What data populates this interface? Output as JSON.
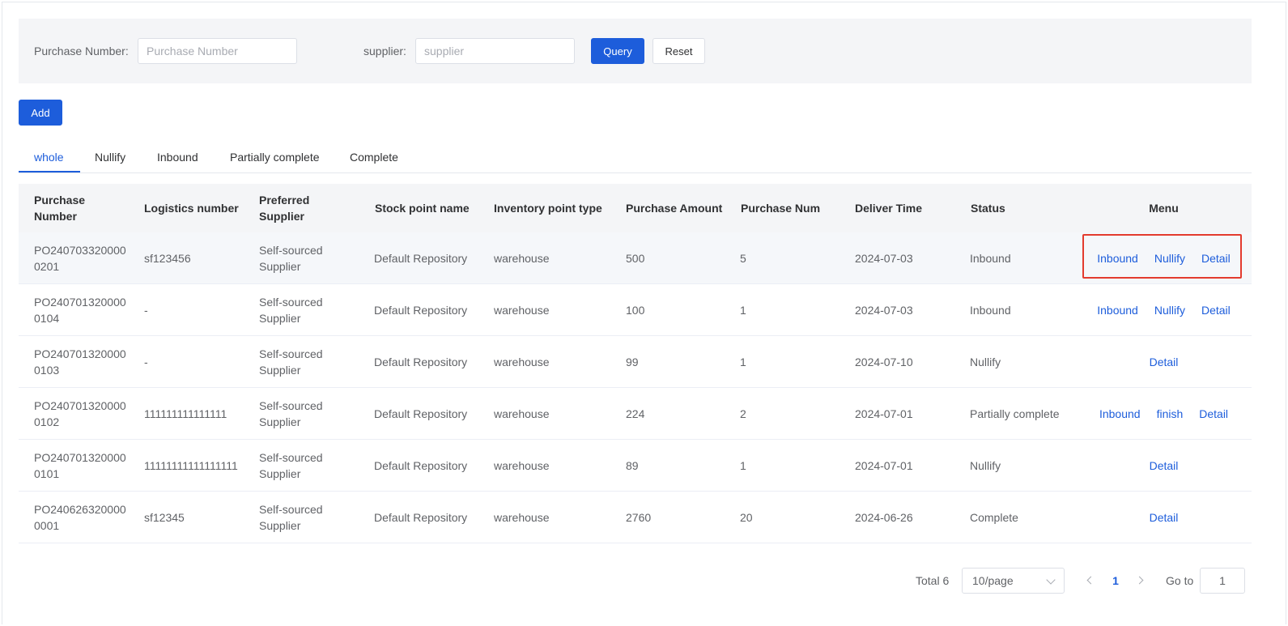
{
  "search": {
    "purchase_number_label": "Purchase Number:",
    "purchase_number_placeholder": "Purchase Number",
    "purchase_number_value": "",
    "supplier_label": "supplier:",
    "supplier_placeholder": "supplier",
    "supplier_value": "",
    "query_label": "Query",
    "reset_label": "Reset"
  },
  "toolbar": {
    "add_label": "Add"
  },
  "tabs": [
    {
      "label": "whole",
      "active": true
    },
    {
      "label": "Nullify",
      "active": false
    },
    {
      "label": "Inbound",
      "active": false
    },
    {
      "label": "Partially complete",
      "active": false
    },
    {
      "label": "Complete",
      "active": false
    }
  ],
  "table": {
    "columns": [
      "Purchase Number",
      "Logistics number",
      "Preferred Supplier",
      "Stock point name",
      "Inventory point type",
      "Purchase Amount",
      "Purchase Num",
      "Deliver Time",
      "Status",
      "Menu"
    ],
    "rows": [
      {
        "purchase_number": "PO2407033200000201",
        "logistics_number": "sf123456",
        "supplier": "Self-sourced Supplier",
        "stock_point": "Default Repository",
        "inventory_type": "warehouse",
        "amount": "500",
        "num": "5",
        "deliver_time": "2024-07-03",
        "status": "Inbound",
        "actions": [
          "Inbound",
          "Nullify",
          "Detail"
        ]
      },
      {
        "purchase_number": "PO2407013200000104",
        "logistics_number": "-",
        "supplier": "Self-sourced Supplier",
        "stock_point": "Default Repository",
        "inventory_type": "warehouse",
        "amount": "100",
        "num": "1",
        "deliver_time": "2024-07-03",
        "status": "Inbound",
        "actions": [
          "Inbound",
          "Nullify",
          "Detail"
        ]
      },
      {
        "purchase_number": "PO2407013200000103",
        "logistics_number": "-",
        "supplier": "Self-sourced Supplier",
        "stock_point": "Default Repository",
        "inventory_type": "warehouse",
        "amount": "99",
        "num": "1",
        "deliver_time": "2024-07-10",
        "status": "Nullify",
        "actions": [
          "Detail"
        ]
      },
      {
        "purchase_number": "PO2407013200000102",
        "logistics_number": "111111111111111",
        "supplier": "Self-sourced Supplier",
        "stock_point": "Default Repository",
        "inventory_type": "warehouse",
        "amount": "224",
        "num": "2",
        "deliver_time": "2024-07-01",
        "status": "Partially complete",
        "actions": [
          "Inbound",
          "finish",
          "Detail"
        ]
      },
      {
        "purchase_number": "PO2407013200000101",
        "logistics_number": "11111111111111111",
        "supplier": "Self-sourced Supplier",
        "stock_point": "Default Repository",
        "inventory_type": "warehouse",
        "amount": "89",
        "num": "1",
        "deliver_time": "2024-07-01",
        "status": "Nullify",
        "actions": [
          "Detail"
        ]
      },
      {
        "purchase_number": "PO2406263200000001",
        "logistics_number": "sf12345",
        "supplier": "Self-sourced Supplier",
        "stock_point": "Default Repository",
        "inventory_type": "warehouse",
        "amount": "2760",
        "num": "20",
        "deliver_time": "2024-06-26",
        "status": "Complete",
        "actions": [
          "Detail"
        ]
      }
    ]
  },
  "pagination": {
    "total_label": "Total 6",
    "page_size": "10/page",
    "current_page": "1",
    "goto_label": "Go to",
    "goto_value": "1"
  },
  "colors": {
    "primary": "#1d5ddb",
    "highlight_box": "#e33b2e"
  }
}
